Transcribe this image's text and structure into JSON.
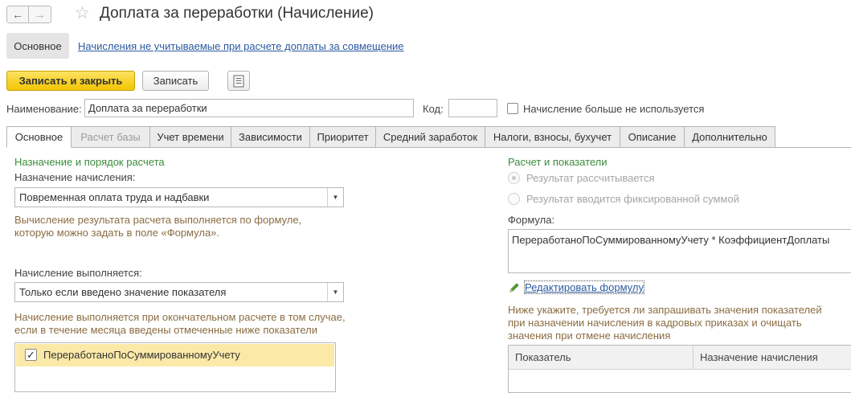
{
  "window": {
    "title": "Доплата за переработки (Начисление)"
  },
  "navigation": {
    "main_label": "Основное",
    "link_label": "Начисления не учитываемые при расчете доплаты за совмещение"
  },
  "toolbar": {
    "save_close_label": "Записать и закрыть",
    "save_label": "Записать"
  },
  "header": {
    "name_label": "Наименование:",
    "name_value": "Доплата за переработки",
    "code_label": "Код:",
    "code_value": "",
    "unused_label": "Начисление больше не используется"
  },
  "tabs": [
    {
      "label": "Основное"
    },
    {
      "label": "Расчет базы"
    },
    {
      "label": "Учет времени"
    },
    {
      "label": "Зависимости"
    },
    {
      "label": "Приоритет"
    },
    {
      "label": "Средний заработок"
    },
    {
      "label": "Налоги, взносы, бухучет"
    },
    {
      "label": "Описание"
    },
    {
      "label": "Дополнительно"
    }
  ],
  "left": {
    "group_title": "Назначение и порядок расчета",
    "purpose_label": "Назначение начисления:",
    "purpose_value": "Повременная оплата труда и надбавки",
    "purpose_hint_1": "Вычисление результата расчета выполняется по формуле,",
    "purpose_hint_2": "которую можно задать в поле «Формула».",
    "execution_label": "Начисление выполняется:",
    "execution_value": "Только если введено значение показателя",
    "execution_hint_1": "Начисление выполняется при окончательном расчете в том случае,",
    "execution_hint_2": "если в течение месяца введены отмеченные ниже показатели",
    "indicators": [
      {
        "label": "ПереработаноПоСуммированномуУчету",
        "checked": true
      }
    ]
  },
  "right": {
    "group_title": "Расчет и показатели",
    "radio_calculated": "Результат рассчитывается",
    "radio_fixed": "Результат вводится фиксированной суммой",
    "formula_label": "Формула:",
    "formula_value": "ПереработаноПоСуммированномуУчету * КоэффициентДоплаты",
    "edit_formula_label": "Редактировать формулу",
    "hint_1": "Ниже укажите, требуется ли запрашивать значения показателей",
    "hint_2": "при назначении начисления в кадровых приказах и очищать",
    "hint_3": "значения при отмене начисления",
    "table_columns": [
      "Показатель",
      "Назначение начисления"
    ]
  },
  "colors": {
    "accent_yellow": "#f2c500",
    "group_title_green": "#3a8b3a",
    "hint_brown": "#8a6c42",
    "link_blue": "#2c5aa0",
    "selected_row": "#fbe9a8"
  }
}
